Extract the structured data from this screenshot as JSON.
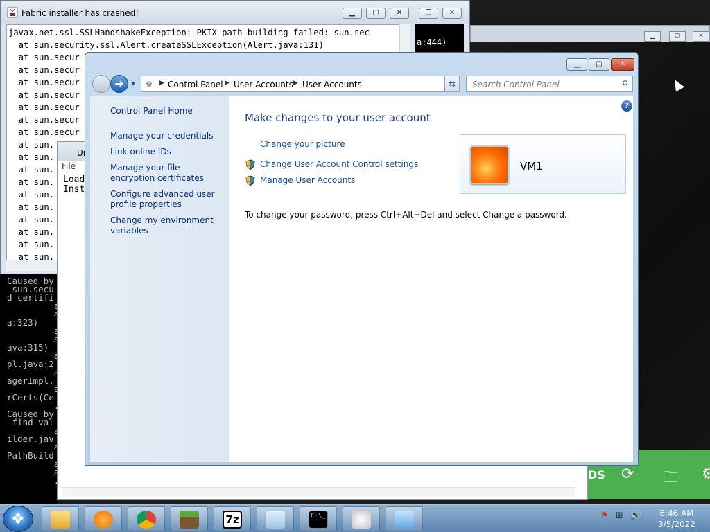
{
  "crash_window": {
    "title": "Fabric installer has crashed!",
    "lines": [
      "javax.net.ssl.SSLHandshakeException: PKIX path building failed: sun.sec",
      "  at sun.security.ssl.Alert.createSSLException(Alert.java:131)",
      "  at sun.secur",
      "  at sun.secur",
      "  at sun.secur",
      "  at sun.secur",
      "  at sun.secur",
      "  at sun.secur",
      "  at sun.secur",
      "  at sun.",
      "  at sun.",
      "  at sun.",
      "  at sun.",
      "  at sun.",
      "  at sun.",
      "  at sun.",
      "  at sun.",
      "  at sun.",
      "  at sun."
    ],
    "side_text": "a:444)"
  },
  "console": {
    "lines": [
      "Caused by",
      " sun.secu",
      "d certifi",
      "         a",
      "         a",
      "a:323)",
      "         a",
      "         a",
      "ava:315)",
      "         a",
      "pl.java:2",
      "         a",
      "agerImpl.",
      "         a",
      "rCerts(Ce",
      "         .",
      "Caused by",
      " find val",
      "         a",
      "ilder.jav",
      "         a",
      "PathBuild",
      "         a",
      "         a",
      "         ."
    ]
  },
  "under_window": {
    "title": "Ur",
    "menu": "File",
    "lines": [
      "Load",
      "Inst"
    ]
  },
  "control_panel": {
    "nav": {
      "breadcrumbs": [
        "Control Panel",
        "User Accounts",
        "User Accounts"
      ],
      "search_placeholder": "Search Control Panel"
    },
    "sidebar": {
      "home": "Control Panel Home",
      "links": [
        "Manage your credentials",
        "Link online IDs",
        "Manage your file encryption certificates",
        "Configure advanced user profile properties",
        "Change my environment variables"
      ]
    },
    "main": {
      "heading": "Make changes to your user account",
      "tasks": [
        "Change your picture",
        "Change User Account Control settings",
        "Manage User Accounts"
      ],
      "account_name": "VM1",
      "password_note": "To change your password, press Ctrl+Alt+Del and select Change a password."
    }
  },
  "taskbar": {
    "clock_time": "6:46 AM",
    "clock_date": "3/5/2022",
    "apps": [
      "file-explorer-icon",
      "media-player-icon",
      "chrome-icon",
      "minecraft-icon",
      "7zip-icon",
      "notepad-icon",
      "cmd-icon",
      "java-icon",
      "control-panel-icon"
    ]
  },
  "mc_strip": {
    "text": "DS"
  },
  "colors": {
    "link": "#0b4aa6",
    "heading": "#1f3d8e",
    "sidebar_bg": "#dfe9f4"
  }
}
